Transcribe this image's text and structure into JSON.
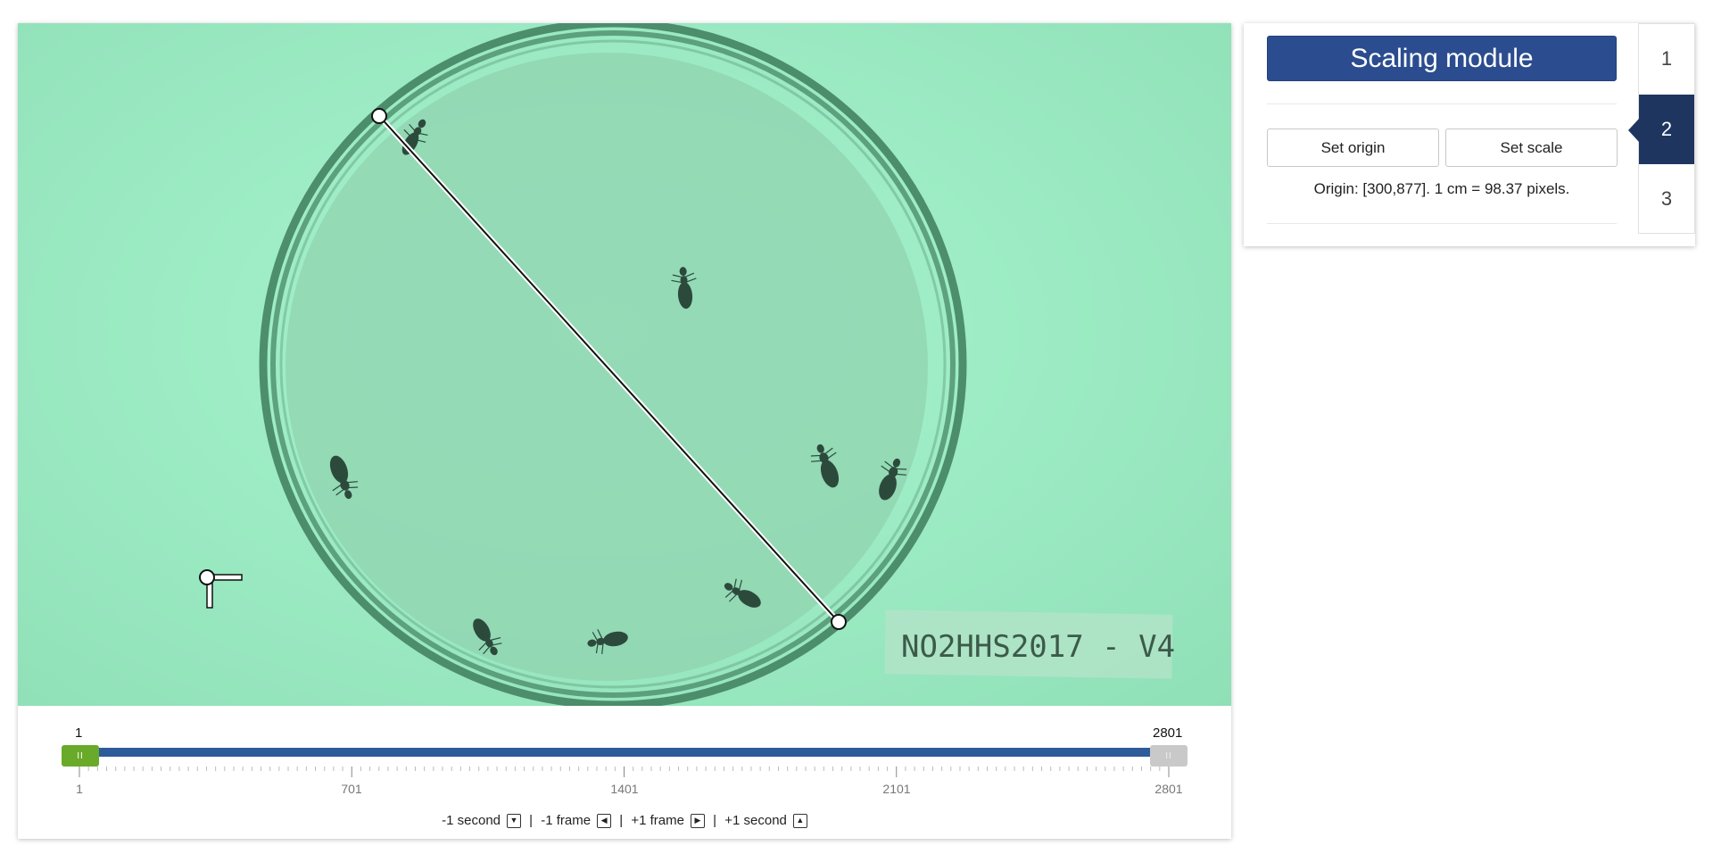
{
  "video": {
    "label_text": "NO2HHS2017 - V4"
  },
  "timeline": {
    "min_label": "1",
    "max_label": "2801",
    "range": {
      "start": 1,
      "end": 2801
    },
    "tick_labels": [
      "1",
      "701",
      "1401",
      "2101",
      "2801"
    ],
    "handle_grip": "II",
    "controls": {
      "back_second": "-1 second",
      "back_frame": "-1 frame",
      "forward_frame": "+1 frame",
      "forward_second": "+1 second",
      "separator": "|"
    }
  },
  "module": {
    "title": "Scaling module",
    "set_origin_label": "Set origin",
    "set_scale_label": "Set scale",
    "status": "Origin: [300,877]. 1 cm = 98.37 pixels.",
    "steps": [
      "1",
      "2",
      "3"
    ],
    "active_step": "2"
  },
  "colors": {
    "accent": "#2b4d8f",
    "active_step": "#1e3560",
    "slider_start": "#6aaa2a",
    "slider_track": "#2e5b9a",
    "video_bg": "#9eedc6"
  },
  "icons": {
    "back_second": "arrow-down-key-icon",
    "back_frame": "arrow-left-key-icon",
    "forward_frame": "arrow-right-key-icon",
    "forward_second": "arrow-up-key-icon"
  }
}
